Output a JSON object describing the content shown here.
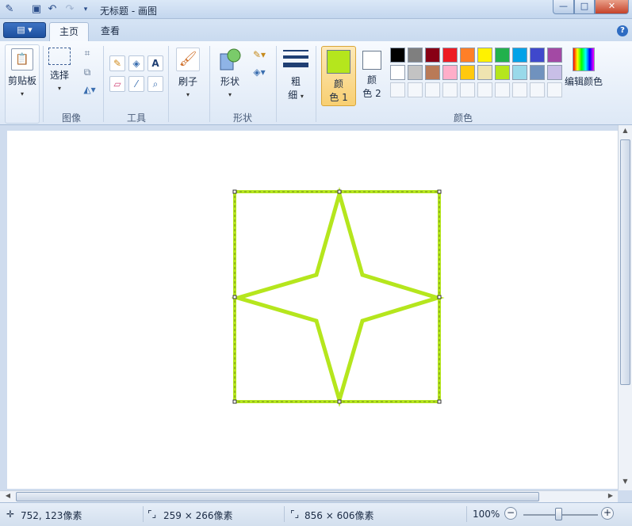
{
  "window": {
    "title": "无标题 - 画图"
  },
  "tabs": {
    "home": "主页",
    "view": "查看"
  },
  "groups": {
    "clipboard": "剪贴板",
    "image": "图像",
    "tools": "工具",
    "shapes": "形状",
    "colors": "颜色"
  },
  "buttons": {
    "select": "选择",
    "brushes": "刷子",
    "shapes": "形状",
    "size_line1": "粗",
    "size_line2": "细",
    "color1_line1": "颜",
    "color1_line2": "色 1",
    "color2_line1": "颜",
    "color2_line2": "色 2",
    "edit_colors": "编辑颜色"
  },
  "palette": {
    "row1": [
      "#000000",
      "#7f7f7f",
      "#880015",
      "#ed1c24",
      "#ff7f27",
      "#fff200",
      "#22b14c",
      "#00a2e8",
      "#3f48cc",
      "#a349a4"
    ],
    "row2": [
      "#ffffff",
      "#c3c3c3",
      "#b97a57",
      "#ffaec9",
      "#ffc90e",
      "#efe4b0",
      "#b5e61d",
      "#99d9ea",
      "#7092be",
      "#c8bfe7"
    ]
  },
  "colors": {
    "color1": "#b5e61d",
    "color2": "#ffffff",
    "accent": "#2e6cc2"
  },
  "status": {
    "cursor_pos": "752, 123像素",
    "selection_size": "259 × 266像素",
    "canvas_size": "856 × 606像素",
    "zoom": "100%"
  }
}
